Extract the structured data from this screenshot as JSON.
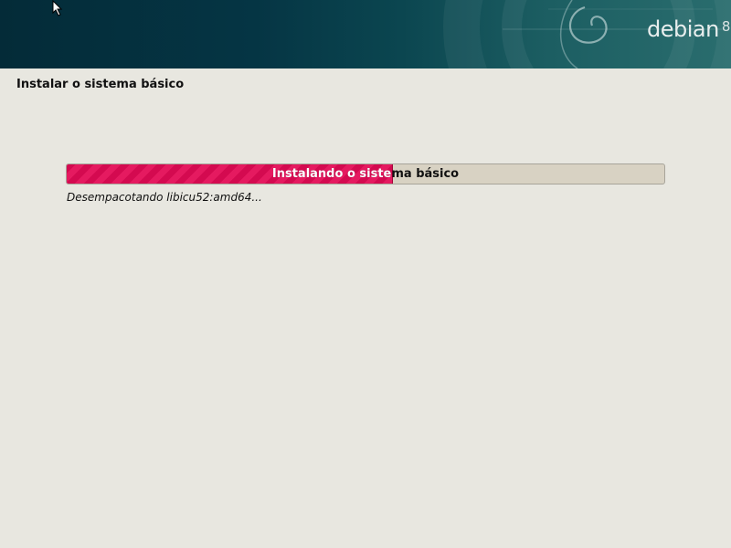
{
  "banner": {
    "logo_text": "debian",
    "logo_version": "8"
  },
  "page": {
    "title": "Instalar o sistema básico"
  },
  "progress": {
    "label": "Instalando o sistema básico",
    "percent": 54.5,
    "status": "Desempacotando libicu52:amd64..."
  },
  "colors": {
    "banner_dark": "#042b38",
    "banner_light": "#2a6d6e",
    "background": "#e8e7e0",
    "progress_fill": "#d40a50",
    "progress_track": "#d8d2c3"
  }
}
